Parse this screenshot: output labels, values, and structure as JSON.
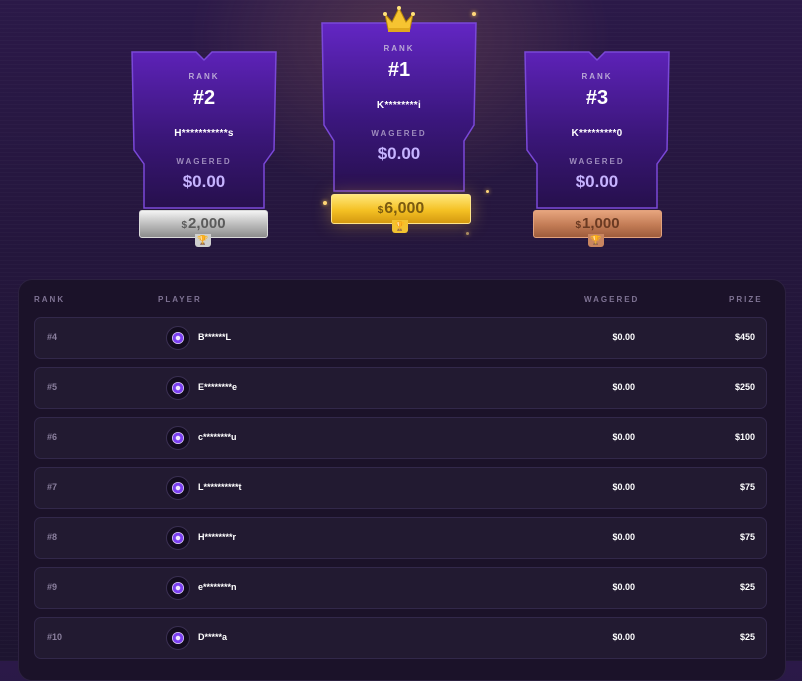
{
  "podium": [
    {
      "rank_label": "RANK",
      "rank": "#2",
      "user": "H***********s",
      "wagered_label": "WAGERED",
      "wagered": "$0.00",
      "prize_currency": "$",
      "prize": "2,000",
      "tier": "silver"
    },
    {
      "rank_label": "RANK",
      "rank": "#1",
      "user": "K********i",
      "wagered_label": "WAGERED",
      "wagered": "$0.00",
      "prize_currency": "$",
      "prize": "6,000",
      "tier": "gold"
    },
    {
      "rank_label": "RANK",
      "rank": "#3",
      "user": "K*********0",
      "wagered_label": "WAGERED",
      "wagered": "$0.00",
      "prize_currency": "$",
      "prize": "1,000",
      "tier": "bronze"
    }
  ],
  "table": {
    "headers": {
      "rank": "RANK",
      "player": "PLAYER",
      "wagered": "WAGERED",
      "prize": "PRIZE"
    },
    "rows": [
      {
        "rank": "#4",
        "player": "B******L",
        "wagered": "$0.00",
        "prize": "$450"
      },
      {
        "rank": "#5",
        "player": "E********e",
        "wagered": "$0.00",
        "prize": "$250"
      },
      {
        "rank": "#6",
        "player": "c********u",
        "wagered": "$0.00",
        "prize": "$100"
      },
      {
        "rank": "#7",
        "player": "L**********t",
        "wagered": "$0.00",
        "prize": "$75"
      },
      {
        "rank": "#8",
        "player": "H********r",
        "wagered": "$0.00",
        "prize": "$75"
      },
      {
        "rank": "#9",
        "player": "e********n",
        "wagered": "$0.00",
        "prize": "$25"
      },
      {
        "rank": "#10",
        "player": "D*****a",
        "wagered": "$0.00",
        "prize": "$25"
      }
    ]
  },
  "colors": {
    "accent": "#c6b3ff",
    "gold": "#f4c023",
    "silver": "#b9b9b9",
    "bronze": "#c27b55",
    "background": "#24163c"
  },
  "icons": {
    "crown": "crown-icon",
    "trophy": "trophy-icon",
    "avatar": "poker-chip-avatar-icon"
  }
}
